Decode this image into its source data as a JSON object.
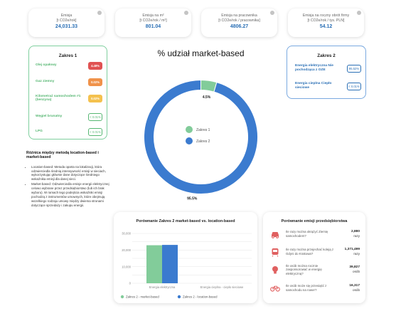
{
  "kpis": [
    {
      "label_line1": "Emisja",
      "label_line2": "[t CO2e/rok]",
      "value": "24,031.33"
    },
    {
      "label_line1": "Emisja na m²",
      "label_line2": "[t CO2e/rok / m²]",
      "value": "801.04"
    },
    {
      "label_line1": "Emisja na pracownika",
      "label_line2": "[t CO2e/rok / pracownika]",
      "value": "4806.27"
    },
    {
      "label_line1": "Emisja na roczny obrót firmy",
      "label_line2": "[t CO2e/rok / tys. PLN]",
      "value": "54.12"
    }
  ],
  "scope1": {
    "title": "Zakres 1",
    "items": [
      {
        "name": "Olej opałowy",
        "value": "4.48%",
        "color": "#e05252",
        "style": "filled"
      },
      {
        "name": "Gaz ziemny",
        "value": "0.02%",
        "color": "#f0924a",
        "style": "filled"
      },
      {
        "name": "Kilometraż samochodem #1 (benzyna)",
        "value": "0.02%",
        "color": "#f4c14e",
        "style": "filled"
      },
      {
        "name": "Węgiel brunatny",
        "value": "< 0.01%",
        "color": "#56b772",
        "style": "outline"
      },
      {
        "name": "LPG",
        "value": "< 0.01%",
        "color": "#56b772",
        "style": "outline"
      }
    ]
  },
  "scope2": {
    "title": "Zakres 2",
    "items": [
      {
        "name": "Energia elektryczna Nie pochodząca z OZE",
        "value": "95.52%"
      },
      {
        "name": "Energia cieplna Ciepło sieciowe",
        "value": "< 0.01%"
      }
    ]
  },
  "notes": {
    "heading": "Różnica między metodą location-based i market-based",
    "bullets": [
      "Location-based: Metoda oparta na lokalizacji, która odzwierciedla średnią intensywność emisji w sieciach, wykorzystując głównie dane dotyczące średniego wskaźnika emisji dla danej sieci.",
      "Market-based: Odzwierciedla emisje energii elektrycznej celowo wybrane przez przedsiębiorstwo (lub ich brak wyboru). W ramach tego podejścia wskaźniki emisji pochodzą z instrumentów umownych, które obejmują wszelkiego rodzaju umowy między dwiema stronami dotyczące sprzedaży i zakupu energii."
    ]
  },
  "donut": {
    "title": "% udział market-based",
    "slices": [
      {
        "name": "Zakres 1",
        "value": 4.5,
        "label": "4.5%",
        "color": "#82cc9a"
      },
      {
        "name": "Zakres 2",
        "value": 95.5,
        "label": "95.5%",
        "color": "#3b7bcf"
      }
    ]
  },
  "chart_data": {
    "type": "bar",
    "title": "Porównanie Zakres 2 market-based vs. location-based",
    "categories": [
      "Energia elektryczna",
      "Energia cieplna - ciepło sieciowe"
    ],
    "series": [
      {
        "name": "Zakres 2 - market-based",
        "values": [
          22900,
          0
        ],
        "color": "#82cc9a"
      },
      {
        "name": "Zakres 2 - location-based",
        "values": [
          23100,
          0
        ],
        "color": "#3b7bcf"
      }
    ],
    "yticks": [
      0,
      5000,
      10000,
      15000,
      20000,
      25000,
      30000
    ],
    "ytick_labels": [
      "0",
      "",
      "10,000",
      "",
      "20,000",
      "",
      "30,000"
    ],
    "ylim": [
      0,
      30000
    ],
    "grid": true,
    "legend": "bottom"
  },
  "comparison": {
    "title": "Porównanie emisji przedsiębiorstwa",
    "rows": [
      {
        "icon": "car-icon",
        "question": "Ile razy można okrążyć Ziemię samochodem?",
        "value": "2,880",
        "unit": "razy"
      },
      {
        "icon": "train-icon",
        "question": "Ile razy można przejechać koleją z Gdyni do Krakowa?",
        "value": "1,371,499",
        "unit": "razy"
      },
      {
        "icon": "lightbulb-icon",
        "question": "Ile osób można rocznie zasponsorować w energię elektryczną?",
        "value": "39,827",
        "unit": "osób"
      },
      {
        "icon": "bicycle-icon",
        "question": "Ile osób może się przesiąść z samochodu na rower?",
        "value": "16,317",
        "unit": "osób"
      }
    ]
  }
}
